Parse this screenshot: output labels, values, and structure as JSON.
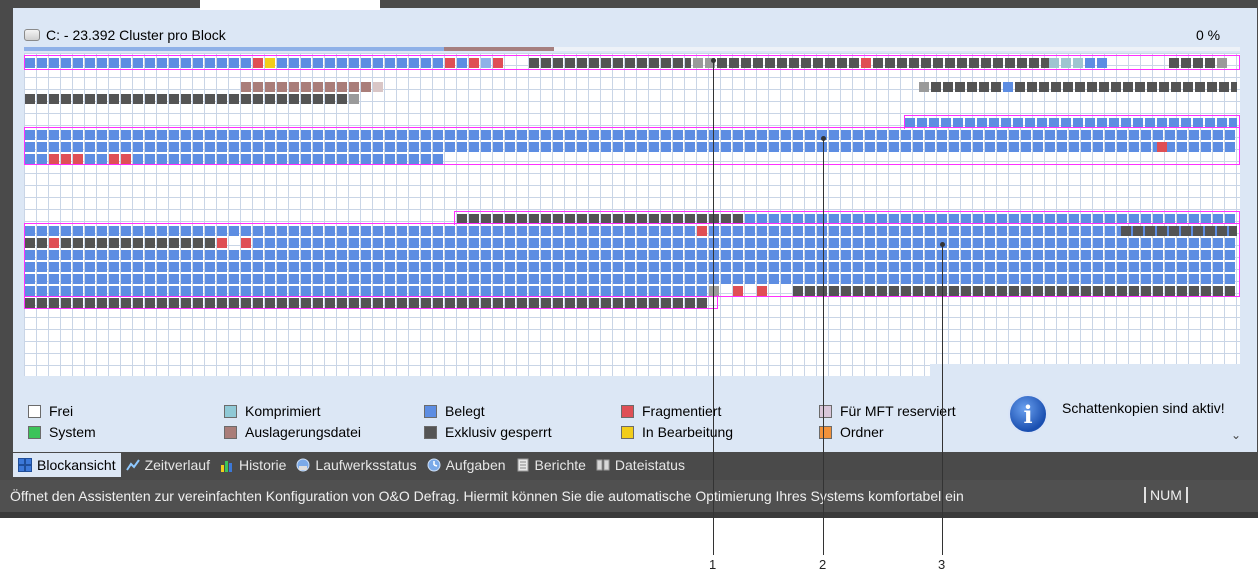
{
  "header": {
    "title": "C: - 23.392 Cluster pro Block",
    "percent": "0 %"
  },
  "legend": [
    {
      "label": "Frei",
      "color": "#ffffff"
    },
    {
      "label": "System",
      "color": "#3cc35a"
    },
    {
      "label": "Komprimiert",
      "color": "#8fc9d6"
    },
    {
      "label": "Auslagerungsdatei",
      "color": "#a97d79"
    },
    {
      "label": "Belegt",
      "color": "#5d8de2"
    },
    {
      "label": "Exklusiv gesperrt",
      "color": "#545454"
    },
    {
      "label": "Fragmentiert",
      "color": "#df4f55"
    },
    {
      "label": "In Bearbeitung",
      "color": "#f2cd1a"
    },
    {
      "label": "Für MFT reserviert",
      "color": "#d9c6d9"
    },
    {
      "label": "Ordner",
      "color": "#f2923a"
    }
  ],
  "info": {
    "text": "Schattenkopien sind aktiv!",
    "icon": "info-icon"
  },
  "tabs": [
    {
      "label": "Blockansicht",
      "icon": "block-view-icon",
      "active": true
    },
    {
      "label": "Zeitverlauf",
      "icon": "timeline-icon",
      "active": false
    },
    {
      "label": "Historie",
      "icon": "history-chart-icon",
      "active": false
    },
    {
      "label": "Laufwerksstatus",
      "icon": "drive-status-icon",
      "active": false
    },
    {
      "label": "Aufgaben",
      "icon": "tasks-icon",
      "active": false
    },
    {
      "label": "Berichte",
      "icon": "reports-icon",
      "active": false
    },
    {
      "label": "Dateistatus",
      "icon": "file-status-icon",
      "active": false
    }
  ],
  "statusbar": {
    "text": "Öffnet den Assistenten zur vereinfachten Konfiguration von O&O Defrag. Hiermit können Sie die automatische Optimierung Ihres Systems komfortabel ein",
    "num": "NUM"
  },
  "callouts": [
    "1",
    "2",
    "3"
  ],
  "colors": {
    "used": "#5d8de2",
    "locked": "#545454",
    "fragmented": "#df4f55",
    "paging": "#a97d79",
    "selection": "#ff30ff",
    "background": "#dce7f5"
  }
}
